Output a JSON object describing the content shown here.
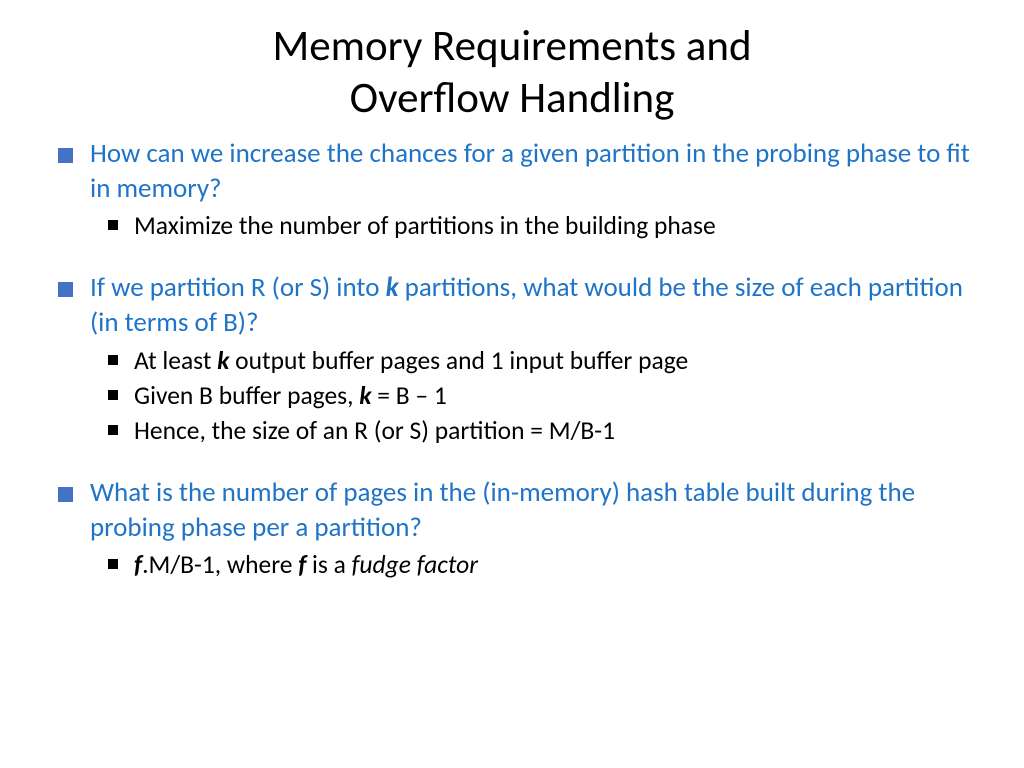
{
  "title_line1": "Memory Requirements and",
  "title_line2": "Overflow Handling",
  "bullets": {
    "b1": {
      "q": "How can we increase the chances for a given partition in the probing phase to fit in memory?",
      "a1": "Maximize the number of partitions in the building phase"
    },
    "b2": {
      "q_pre": "If we partition R (or S) into ",
      "q_k": "k",
      "q_post": " partitions, what would be the size of each partition (in terms of B)?",
      "a1_pre": "At least ",
      "a1_k": "k",
      "a1_post": " output buffer pages and 1 input buffer page",
      "a2_pre": "Given B buffer pages, ",
      "a2_k": "k",
      "a2_post": " = B – 1",
      "a3": "Hence, the size of an R (or S) partition = M/B-1"
    },
    "b3": {
      "q": "What is the number of pages in the (in-memory) hash table built during the probing phase per a partition?",
      "a1_f1": "f",
      "a1_mid": ".M/B-1, where ",
      "a1_f2": "f",
      "a1_post": " is a ",
      "a1_ff": "fudge factor"
    }
  }
}
